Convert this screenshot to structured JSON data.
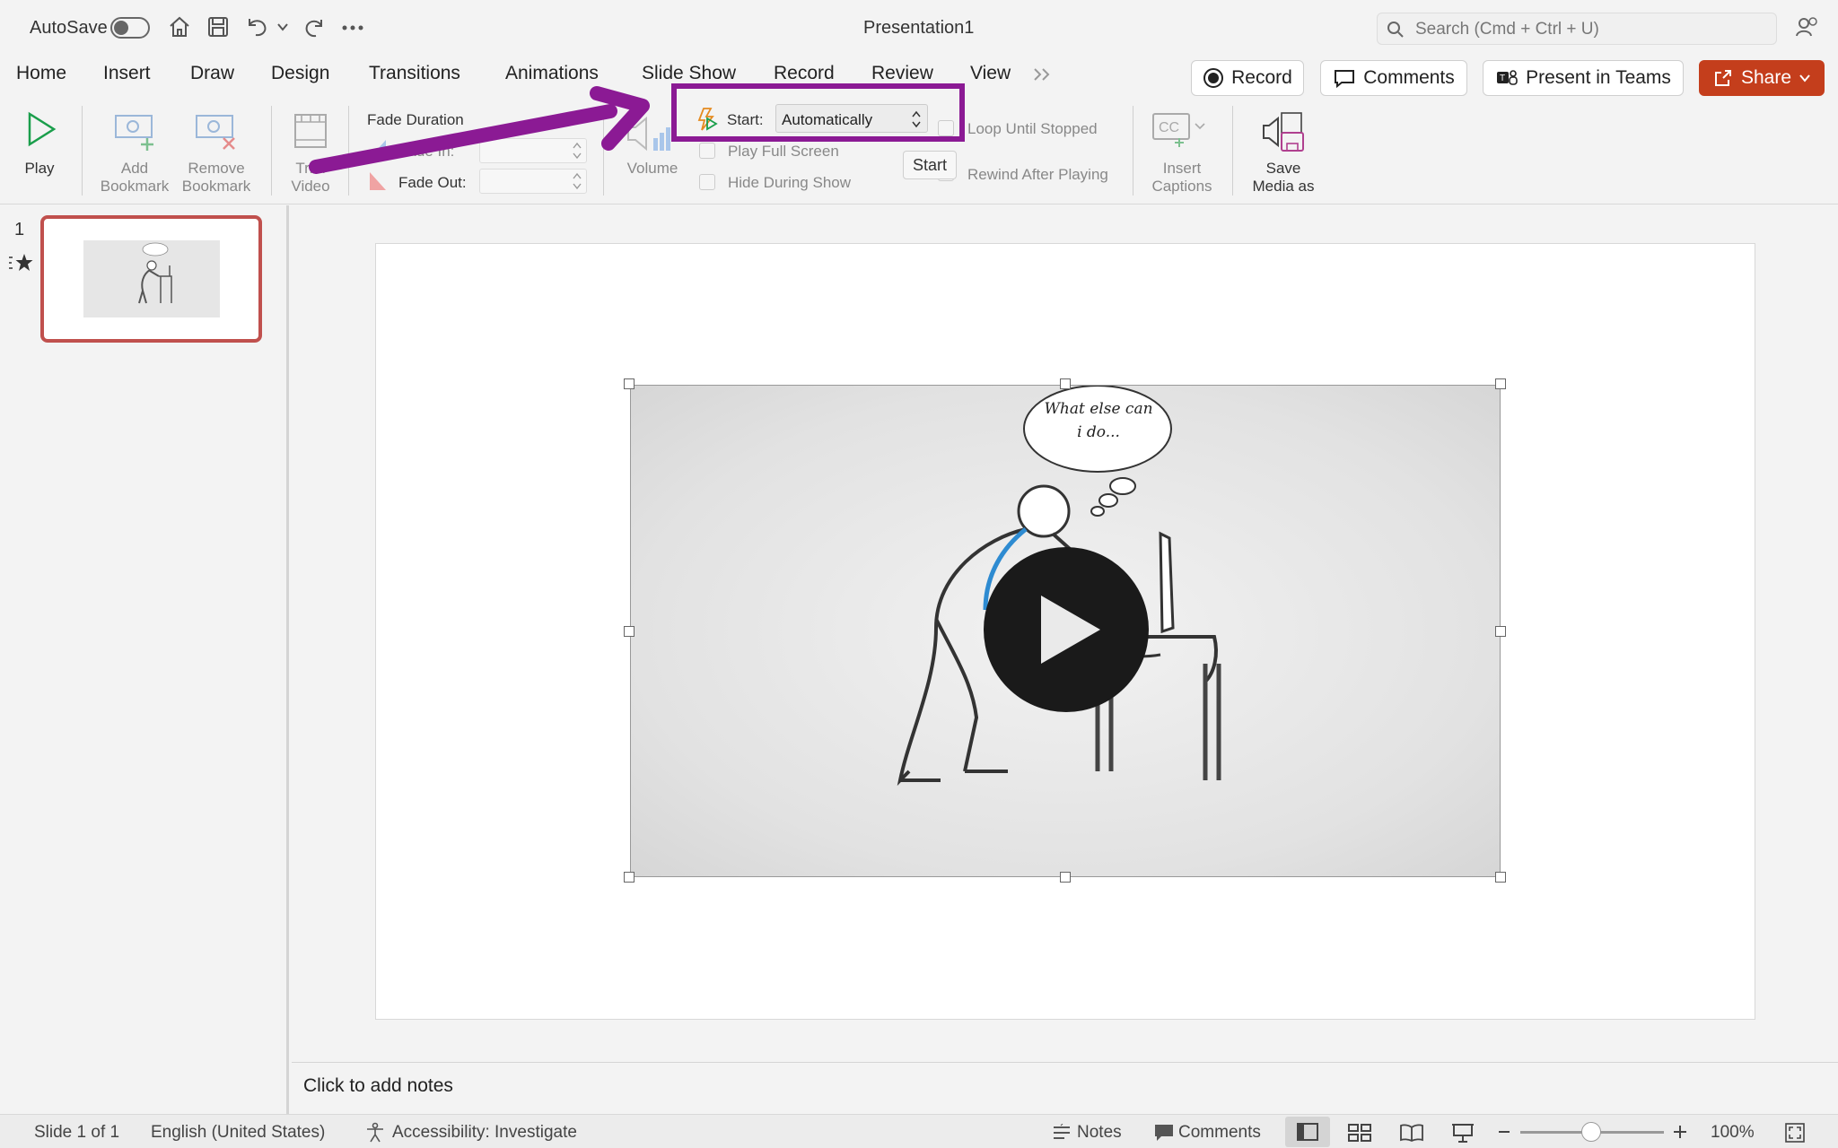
{
  "titlebar": {
    "autosave_label": "AutoSave",
    "title": "Presentation1",
    "search_placeholder": "Search (Cmd + Ctrl + U)"
  },
  "tabs": [
    {
      "label": "Home"
    },
    {
      "label": "Insert"
    },
    {
      "label": "Draw"
    },
    {
      "label": "Design"
    },
    {
      "label": "Transitions"
    },
    {
      "label": "Animations"
    },
    {
      "label": "Slide Show"
    },
    {
      "label": "Record"
    },
    {
      "label": "Review"
    },
    {
      "label": "View"
    }
  ],
  "header_buttons": {
    "record": "Record",
    "comments": "Comments",
    "present_in_teams": "Present in Teams",
    "share": "Share"
  },
  "ribbon": {
    "play": "Play",
    "add_bookmark_1": "Add",
    "add_bookmark_2": "Bookmark",
    "remove_bookmark_1": "Remove",
    "remove_bookmark_2": "Bookmark",
    "trim_video_1": "Trim",
    "trim_video_2": "Video",
    "fade_duration": "Fade Duration",
    "fade_in": "Fade In:",
    "fade_out": "Fade Out:",
    "volume": "Volume",
    "start_label": "Start:",
    "start_value": "Automatically",
    "play_full_screen": "Play Full Screen",
    "hide_during_show": "Hide During Show",
    "loop_until_stopped": "Loop Until Stopped",
    "rewind_after_playing": "Rewind After Playing",
    "insert_captions_1": "Insert",
    "insert_captions_2": "Captions",
    "save_media_1": "Save",
    "save_media_2": "Media as",
    "tooltip": "Start"
  },
  "slides_panel": {
    "slide_number": "1"
  },
  "video": {
    "thought_line1": "What else can",
    "thought_line2": "i do..."
  },
  "notes": {
    "placeholder": "Click to add notes"
  },
  "statusbar": {
    "slide_count": "Slide 1 of 1",
    "language": "English (United States)",
    "accessibility": "Accessibility: Investigate",
    "notes": "Notes",
    "comments": "Comments",
    "zoom": "100%"
  },
  "colors": {
    "annotation": "#8b1a94",
    "share": "#c43e1c",
    "thumb_border": "#c0504d"
  }
}
